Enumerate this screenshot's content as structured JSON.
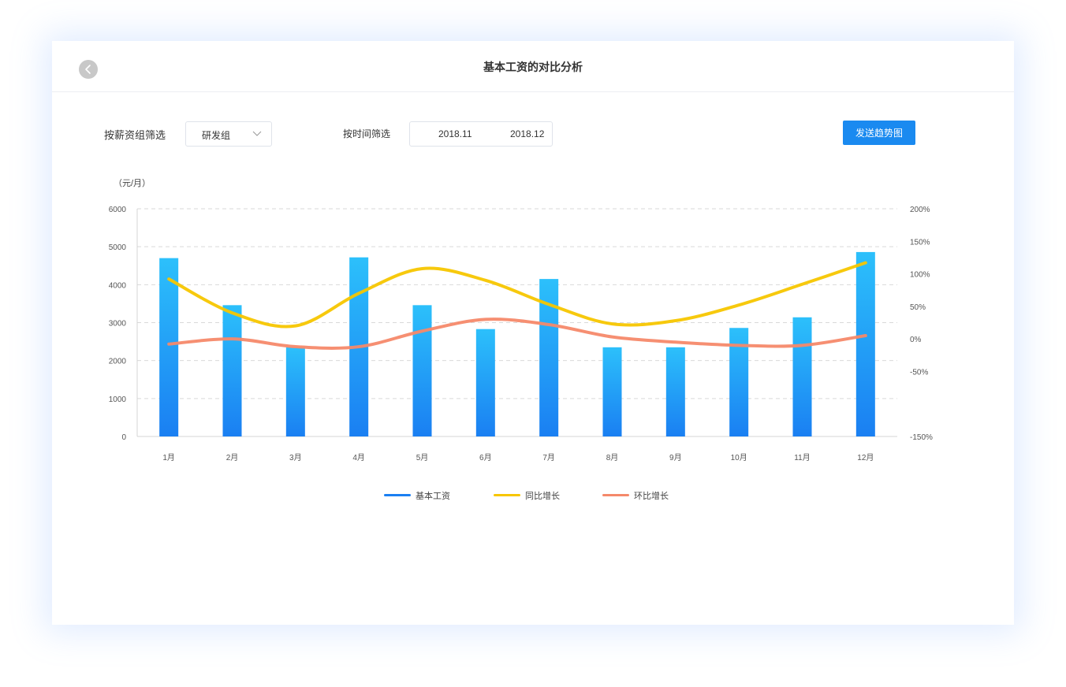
{
  "header": {
    "title": "基本工资的对比分析"
  },
  "filters": {
    "group_label": "按薪资组筛选",
    "group_value": "研发组",
    "time_label": "按时间筛选",
    "date_start": "2018.11",
    "date_end": "2018.12"
  },
  "actions": {
    "send_label": "发送趋势图"
  },
  "colors": {
    "accent": "#1a8af0",
    "bar_top": "#2cc0fb",
    "bar_bottom": "#1a7ff2",
    "yoy": "#f7c600",
    "mom": "#f5896a"
  },
  "chart_data": {
    "type": "bar",
    "unit_label": "（元/月）",
    "categories": [
      "1月",
      "2月",
      "3月",
      "4月",
      "5月",
      "6月",
      "7月",
      "8月",
      "9月",
      "10月",
      "11月",
      "12月"
    ],
    "y_left": {
      "ylim": [
        0,
        6000
      ],
      "ticks": [
        "0",
        "1000",
        "2000",
        "3000",
        "4000",
        "5000",
        "6000"
      ]
    },
    "y_right": {
      "ylim": [
        -150,
        200
      ],
      "ticks": [
        "-150%",
        "-50%",
        "0%",
        "50%",
        "100%",
        "150%",
        "200%"
      ],
      "tick_values": [
        -150,
        -50,
        0,
        50,
        100,
        150,
        200
      ]
    },
    "grid": true,
    "legend_position": "bottom",
    "series": [
      {
        "name": "基本工资",
        "type": "bar",
        "axis": "left",
        "values": [
          4700,
          3460,
          2350,
          4720,
          3460,
          2830,
          4150,
          2350,
          2350,
          2860,
          3140,
          4860
        ]
      },
      {
        "name": "同比增长",
        "type": "line",
        "axis": "right",
        "values": [
          92,
          40,
          20,
          70,
          108,
          90,
          53,
          23,
          28,
          52,
          84,
          117
        ]
      },
      {
        "name": "环比增长",
        "type": "line",
        "axis": "right",
        "values": [
          -8,
          0,
          -12,
          -12,
          12,
          30,
          22,
          3,
          -5,
          -10,
          -10,
          5
        ]
      }
    ]
  }
}
